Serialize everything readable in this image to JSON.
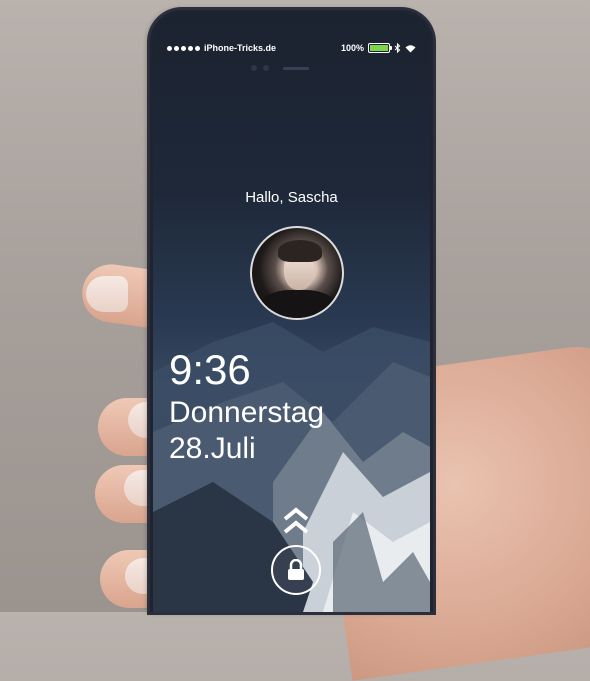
{
  "status_bar": {
    "carrier": "iPhone-Tricks.de",
    "battery_percent_label": "100%",
    "battery_level": 1.0,
    "battery_color": "#7bd64a",
    "signal_dots": 5
  },
  "lock_screen": {
    "greeting": "Hallo, Sascha",
    "time": "9:36",
    "weekday": "Donnerstag",
    "date": "28.Juli"
  },
  "icons": {
    "bluetooth": "bluetooth-icon",
    "wifi": "wifi-icon",
    "swipe_up": "double-chevron-up-icon",
    "lock": "lock-icon"
  },
  "colors": {
    "screen_top": "#1c2330",
    "text": "#ffffff"
  }
}
